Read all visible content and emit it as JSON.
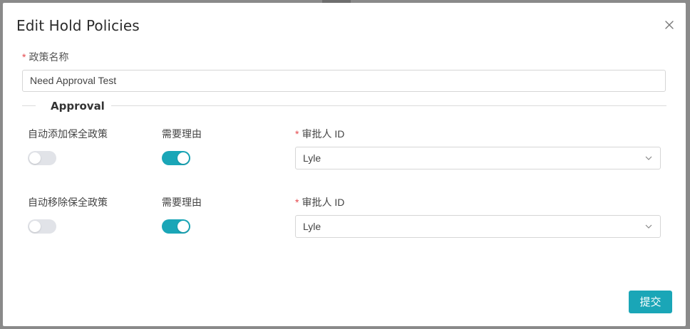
{
  "dialog": {
    "title": "Edit Hold Policies",
    "close_icon": "close-icon"
  },
  "policy_name": {
    "required_mark": "*",
    "label": "政策名称",
    "value": "Need Approval Test"
  },
  "section": {
    "title": "Approval"
  },
  "rows": [
    {
      "auto_label": "自动添加保全政策",
      "auto_enabled": false,
      "reason_label": "需要理由",
      "reason_enabled": true,
      "approver_required_mark": "*",
      "approver_label": "审批人 ID",
      "approver_value": "Lyle"
    },
    {
      "auto_label": "自动移除保全政策",
      "auto_enabled": false,
      "reason_label": "需要理由",
      "reason_enabled": true,
      "approver_required_mark": "*",
      "approver_label": "审批人 ID",
      "approver_value": "Lyle"
    }
  ],
  "footer": {
    "submit_label": "提交"
  },
  "colors": {
    "accent": "#1aa6b7",
    "required": "#e5484d",
    "switch_off": "#e1e3e8"
  }
}
